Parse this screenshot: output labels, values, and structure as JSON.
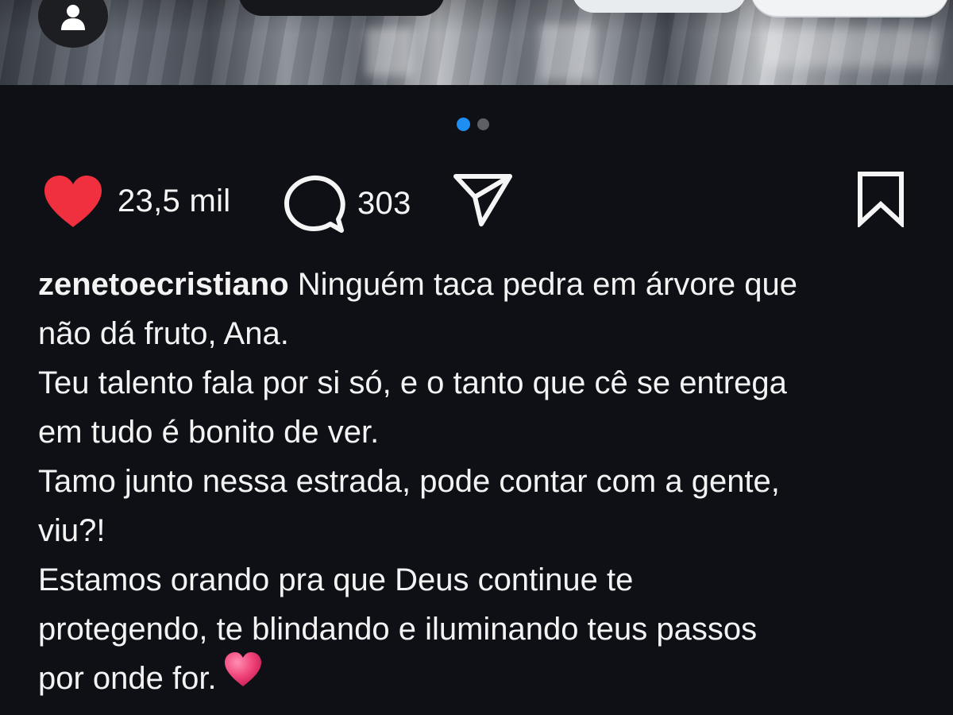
{
  "post": {
    "username": "zenetoecristiano",
    "likes": "23,5 mil",
    "comments": "303",
    "carousel": {
      "total": 2,
      "active": 1
    },
    "caption_lines": [
      "não dá fruto, Ana.",
      "Teu talento fala por si só, e o tanto que cê se entrega",
      "em tudo é bonito de ver.",
      "Tamo junto nessa estrada, pode contar com a gente,",
      "viu?!",
      "Estamos orando pra que Deus continue te",
      "protegendo, te blindando e iluminando teus passos",
      "por onde for."
    ],
    "caption_first_line": "Ninguém taca pedra em árvore que"
  },
  "icons": {
    "avatar": "person-icon",
    "like": "heart-filled-icon",
    "comment": "comment-bubble-icon",
    "share": "paper-plane-icon",
    "save": "bookmark-icon",
    "emoji": "pink-heart-emoji"
  },
  "colors": {
    "background": "#0e1016",
    "like_red": "#f0303f",
    "dot_active": "#1e8ef3",
    "dot_inactive": "#5c5f66",
    "emoji_pink": "#f0457a"
  }
}
